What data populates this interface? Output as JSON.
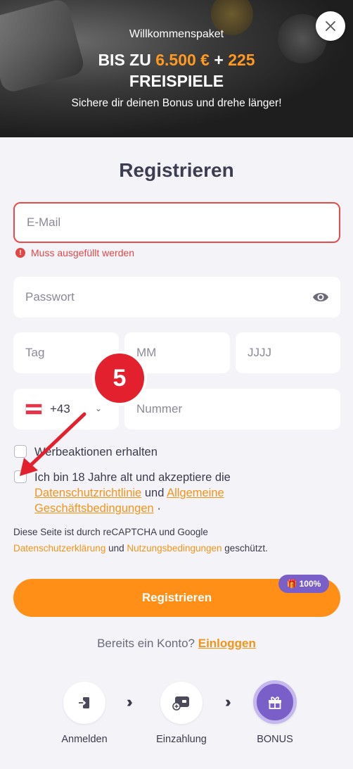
{
  "banner": {
    "subtitle": "Willkommenspaket",
    "headline_prefix": "BIS ZU",
    "amount": "6.500 €",
    "plus": "+",
    "spins": "225",
    "headline_line2": "FREISPIELE",
    "description": "Sichere dir deinen Bonus und drehe länger!"
  },
  "form": {
    "title": "Registrieren",
    "email_placeholder": "E-Mail",
    "email_error": "Muss ausgefüllt werden",
    "password_placeholder": "Passwort",
    "day_placeholder": "Tag",
    "month_placeholder": "MM",
    "year_placeholder": "JJJJ",
    "country_code": "+43",
    "number_placeholder": "Nummer",
    "promo_label": "Werbeaktionen erhalten",
    "terms_prefix": "Ich bin 18 Jahre alt und akzeptiere die",
    "privacy_link": "Datenschutzrichtlinie",
    "terms_and": "und",
    "terms_link": "Allgemeine Geschäftsbedingungen",
    "terms_suffix": "·",
    "recaptcha_prefix": "Diese Seite ist durch reCAPTCHA und Google",
    "recaptcha_privacy": "Datenschutzerklärung",
    "recaptcha_and": "und",
    "recaptcha_terms": "Nutzungsbedingungen",
    "recaptcha_suffix": "geschützt.",
    "submit_label": "Registrieren",
    "bonus_badge": "100%",
    "login_prompt": "Bereits ein Konto?",
    "login_link": "Einloggen"
  },
  "steps": [
    {
      "label": "Anmelden",
      "icon": "login-icon"
    },
    {
      "label": "Einzahlung",
      "icon": "deposit-icon"
    },
    {
      "label": "BONUS",
      "icon": "gift-icon"
    }
  ],
  "annotation": {
    "number": "5"
  },
  "colors": {
    "accent": "#ff8f17",
    "purple": "#7a5fc9",
    "error": "#e94b4b",
    "annotation": "#e3202e"
  }
}
